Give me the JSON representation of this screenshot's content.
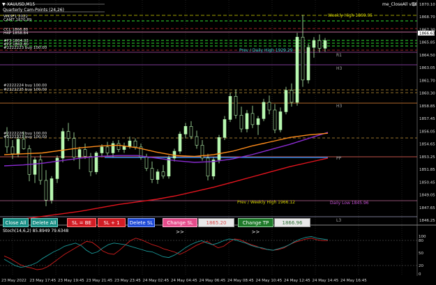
{
  "window": {
    "symbol_title": "XAUUSD,M15",
    "indicator_title": "Quarterly Cam-Points (24,26)",
    "expert_label": "me_CloseAll v3d"
  },
  "left_labels": [
    "WKSF1 2022",
    "CAMT 1870.89",
    "CCL 1866.80",
    "H4P 1858.84",
    "#P3 1864.03",
    "#P2 1862.60"
  ],
  "order_labels": [
    {
      "text": "#2222223 buy 100.00"
    },
    {
      "text": "#2222224 buy 100.00"
    },
    {
      "text": "#2222225 buy 100.00"
    },
    {
      "text": "#2222226 buy 100.00"
    },
    {
      "text": "#2222221 buy 100.00"
    }
  ],
  "level_labels": {
    "weekly_high": "Weekly High 1869.05",
    "prev_daily_high": "Prev / Daily High 1929.29",
    "r1": "R1",
    "h3a": "H3",
    "h3b": "H3",
    "pp": "PP",
    "prev_weekly_high": "Prev / Weekly High 1966.12",
    "daily_low": "Daily Low 1845.96",
    "l3": "L3"
  },
  "price_axis": {
    "ticks": [
      "1870.10",
      "1868.70",
      "1867.30",
      "1865.85",
      "1864.50",
      "1863.05",
      "1861.70",
      "1860.30",
      "1858.85",
      "1857.45",
      "1856.05",
      "1854.65",
      "1853.25",
      "1851.85",
      "1850.45",
      "1849.05",
      "1847.65",
      "1846.25"
    ],
    "current_price": "1866.63"
  },
  "stoch": {
    "title": "Stoch(14,6,2) 85.8949 79.6348",
    "ticks": [
      "100",
      "80",
      "50",
      "20",
      "0"
    ],
    "main_values": [
      38,
      30,
      22,
      18,
      20,
      24,
      30,
      40,
      48,
      56,
      62,
      70,
      74,
      78,
      72,
      60,
      52,
      56,
      66,
      74,
      78,
      76,
      74,
      70,
      66,
      62,
      58,
      56,
      50,
      44,
      42,
      48,
      56,
      66,
      74,
      80,
      84,
      78,
      74,
      78,
      84,
      88,
      86,
      82,
      78,
      72,
      68,
      66,
      62,
      60,
      64,
      68,
      74,
      82,
      88,
      92,
      94,
      90,
      88,
      86
    ],
    "signal_values": [
      46,
      40,
      32,
      24,
      19,
      16,
      12,
      14,
      20,
      30,
      40,
      50,
      58,
      66,
      74,
      82,
      80,
      70,
      58,
      52,
      50,
      60,
      72,
      84,
      90,
      86,
      80,
      74,
      70,
      64,
      60,
      56,
      50,
      56,
      64,
      72,
      78,
      82,
      74,
      66,
      70,
      80,
      88,
      86,
      80,
      74,
      70,
      64,
      62,
      60,
      62,
      66,
      74,
      80,
      84,
      88,
      90,
      86,
      84,
      84
    ]
  },
  "time_axis": [
    "23 May 2022",
    "23 May 17:45",
    "23 May 19:45",
    "23 May 21:45",
    "23 May 23:45",
    "24 May 02:45",
    "24 May 04:45",
    "24 May 06:45",
    "24 May 08:45",
    "24 May 10:45",
    "24 May 12:45",
    "24 May 14:45",
    "24 May 16:45"
  ],
  "buttons": {
    "close_all": "Close All",
    "delete_all": "Delete All",
    "sl_be": "SL = BE",
    "sl_plus1": "SL + 1",
    "delete_sl": "Delete SL",
    "change_sl": "Change SL >>",
    "sl_value": "1865.20",
    "change_tp": "Change TP >>",
    "tp_value": "1866.96"
  },
  "colors": {
    "background": "#000000",
    "bull_candle": "#b7f7b0",
    "ma_orange": "#ff8c1a",
    "ma_purple": "#8a2bd1",
    "ma_red": "#e3141e",
    "ma_blue": "#1f8fff",
    "stoch_main": "#1a9a9a",
    "stoch_signal": "#d11e1e"
  },
  "chart_data": {
    "type": "candlestick",
    "y_range": [
      1845.5,
      1871.0
    ],
    "candles": [
      [
        1855.5,
        1856.5,
        1853.5,
        1854.2
      ],
      [
        1854.2,
        1855.0,
        1852.8,
        1853.4
      ],
      [
        1853.4,
        1855.6,
        1853.0,
        1855.1
      ],
      [
        1855.1,
        1856.0,
        1853.9,
        1854.0
      ],
      [
        1854.0,
        1854.4,
        1850.2,
        1851.0
      ],
      [
        1851.0,
        1853.0,
        1850.0,
        1852.7
      ],
      [
        1852.7,
        1853.3,
        1849.8,
        1850.3
      ],
      [
        1850.3,
        1851.5,
        1847.3,
        1848.0
      ],
      [
        1848.0,
        1850.8,
        1847.6,
        1850.5
      ],
      [
        1850.5,
        1853.2,
        1850.0,
        1852.9
      ],
      [
        1852.9,
        1856.4,
        1852.4,
        1856.0
      ],
      [
        1856.0,
        1857.0,
        1854.9,
        1855.2
      ],
      [
        1855.2,
        1855.9,
        1852.6,
        1853.0
      ],
      [
        1853.0,
        1854.2,
        1851.6,
        1853.9
      ],
      [
        1853.9,
        1854.6,
        1852.8,
        1853.1
      ],
      [
        1853.1,
        1853.5,
        1850.8,
        1851.3
      ],
      [
        1851.3,
        1853.7,
        1851.0,
        1853.5
      ],
      [
        1853.5,
        1854.5,
        1853.0,
        1854.2
      ],
      [
        1854.2,
        1854.8,
        1853.2,
        1853.5
      ],
      [
        1853.5,
        1854.9,
        1853.0,
        1854.6
      ],
      [
        1854.6,
        1855.0,
        1853.6,
        1853.9
      ],
      [
        1853.9,
        1854.7,
        1853.5,
        1854.3
      ],
      [
        1854.3,
        1855.4,
        1854.0,
        1854.9
      ],
      [
        1854.9,
        1855.2,
        1853.9,
        1854.2
      ],
      [
        1854.2,
        1854.6,
        1852.7,
        1853.0
      ],
      [
        1853.0,
        1853.4,
        1851.4,
        1851.7
      ],
      [
        1851.7,
        1852.5,
        1850.0,
        1850.4
      ],
      [
        1850.4,
        1851.6,
        1849.9,
        1851.3
      ],
      [
        1851.3,
        1852.1,
        1850.5,
        1850.8
      ],
      [
        1850.8,
        1853.2,
        1850.5,
        1852.9
      ],
      [
        1852.9,
        1854.0,
        1852.5,
        1853.7
      ],
      [
        1853.7,
        1856.0,
        1853.4,
        1855.7
      ],
      [
        1855.7,
        1857.0,
        1855.2,
        1856.6
      ],
      [
        1856.6,
        1857.2,
        1855.1,
        1855.4
      ],
      [
        1855.4,
        1856.1,
        1854.0,
        1854.4
      ],
      [
        1854.4,
        1855.0,
        1852.6,
        1852.9
      ],
      [
        1852.9,
        1853.4,
        1850.3,
        1850.8
      ],
      [
        1850.8,
        1853.0,
        1850.4,
        1852.7
      ],
      [
        1852.7,
        1855.6,
        1852.3,
        1855.3
      ],
      [
        1855.3,
        1857.8,
        1855.0,
        1857.4
      ],
      [
        1857.4,
        1860.5,
        1857.1,
        1860.1
      ],
      [
        1860.1,
        1860.9,
        1857.5,
        1857.9
      ],
      [
        1857.9,
        1858.9,
        1855.9,
        1856.3
      ],
      [
        1856.3,
        1858.5,
        1855.9,
        1858.1
      ],
      [
        1858.1,
        1859.0,
        1856.4,
        1856.8
      ],
      [
        1856.8,
        1857.8,
        1855.6,
        1857.5
      ],
      [
        1857.5,
        1859.8,
        1857.2,
        1859.4
      ],
      [
        1859.4,
        1860.2,
        1858.0,
        1858.5
      ],
      [
        1858.5,
        1859.2,
        1855.8,
        1856.2
      ],
      [
        1856.2,
        1858.8,
        1855.9,
        1858.3
      ],
      [
        1858.3,
        1861.2,
        1858.0,
        1860.8
      ],
      [
        1860.8,
        1861.6,
        1858.9,
        1859.4
      ],
      [
        1859.4,
        1867.5,
        1859.0,
        1867.0
      ],
      [
        1867.0,
        1869.6,
        1861.2,
        1862.0
      ],
      [
        1862.0,
        1866.2,
        1861.6,
        1865.8
      ],
      [
        1865.8,
        1867.0,
        1864.6,
        1866.6
      ],
      [
        1866.6,
        1867.3,
        1865.2,
        1865.7
      ],
      [
        1865.7,
        1866.9,
        1865.3,
        1866.6
      ]
    ],
    "ma_orange": [
      1853.3,
      1853.4,
      1853.5,
      1853.8,
      1854.1,
      1854.3,
      1854.4,
      1854.1,
      1853.6,
      1853.2,
      1853.1,
      1853.3,
      1853.7,
      1854.3,
      1854.8,
      1855.3,
      1855.6,
      1855.8
    ],
    "ma_purple": [
      1852.0,
      1852.1,
      1852.3,
      1852.6,
      1852.9,
      1853.1,
      1853.2,
      1853.2,
      1852.9,
      1852.6,
      1852.4,
      1852.5,
      1852.8,
      1853.3,
      1853.9,
      1854.5,
      1855.2,
      1855.9
    ],
    "ma_red": [
      1845.6,
      1845.8,
      1846.1,
      1846.4,
      1846.7,
      1847.1,
      1847.5,
      1847.8,
      1848.1,
      1848.5,
      1849.0,
      1849.5,
      1850.1,
      1850.7,
      1851.3,
      1851.9,
      1852.4,
      1852.9
    ]
  }
}
